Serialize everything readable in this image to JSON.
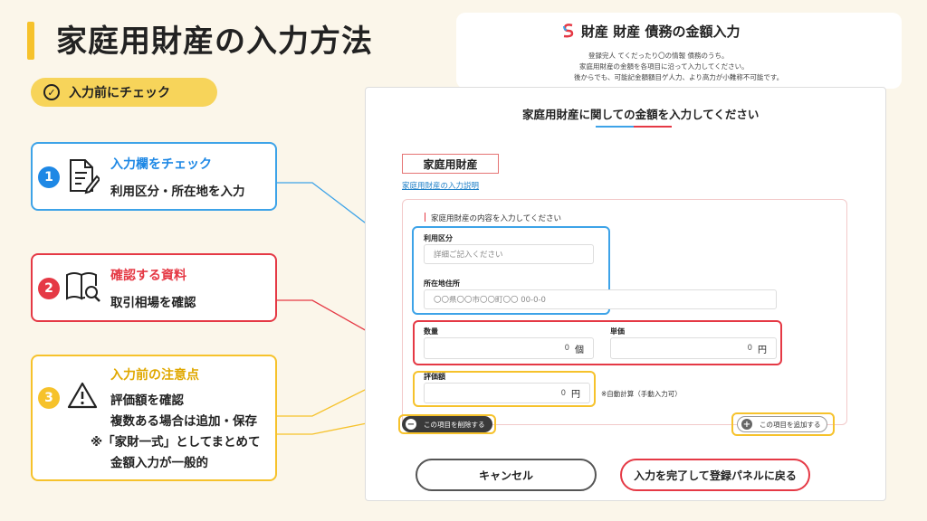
{
  "page": {
    "title": "家庭用財産の入力方法",
    "pill": "入力前にチェック"
  },
  "colors": {
    "accent_yellow": "#f6c22b",
    "blue": "#3da3e8",
    "red": "#e53945",
    "black": "#222222"
  },
  "steps": [
    {
      "number": "1",
      "title": "入力欄をチェック",
      "body": [
        "利用区分・所在地を入力"
      ],
      "icon": "document-pencil-icon"
    },
    {
      "number": "2",
      "title": "確認する資料",
      "body": [
        "取引相場を確認"
      ],
      "icon": "book-magnifier-icon"
    },
    {
      "number": "3",
      "title": "入力前の注意点",
      "body": [
        "評価額を確認",
        "複数ある場合は追加・保存",
        "※「家財一式」としてまとめて",
        "金額入力が一般的"
      ],
      "icon": "warning-icon"
    }
  ],
  "back_panel": {
    "title": "財産 財産 債務の金額入力",
    "lines": [
      "登録完人 てくだったり〇の情報 債務のうち。",
      "家庭用財産の金額を各項目に沿って入力してください。",
      "後からでも、可能記金額額目ゲ人力、より高力が小難称不可能です。"
    ]
  },
  "form": {
    "heading": "家庭用財産に関しての金額を入力してください",
    "tab": "家庭用財産",
    "help_link": "家庭用財産の入力説明",
    "section_label": "家庭用財産の内容を入力してください",
    "usage_label": "利用区分",
    "usage_placeholder": "詳細ご記入ください",
    "location_label": "所在地住所",
    "location_placeholder": "〇〇県〇〇市〇〇町〇〇 00-0-0",
    "quantity_label": "数量",
    "quantity_value": "0",
    "quantity_unit": "個",
    "unit_price_label": "単価",
    "unit_price_value": "0",
    "unit_price_unit": "円",
    "valuation_label": "評価額",
    "valuation_value": "0",
    "valuation_unit": "円",
    "auto_note": "※自動計算（手動入力可）",
    "delete_label": "この項目を削除する",
    "add_label": "この項目を追加する",
    "cancel_label": "キャンセル",
    "complete_label": "入力を完了して登録パネルに戻る"
  }
}
